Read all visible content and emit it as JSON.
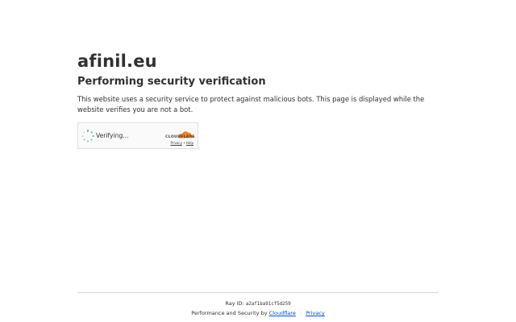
{
  "site": {
    "title": "afinil.eu"
  },
  "main": {
    "heading": "Performing security verification",
    "description": "This website uses a security service to protect against malicious bots. This page is displayed while the website verifies you are not a bot."
  },
  "widget": {
    "status": "Verifying...",
    "brand": "CLOUDFLARE",
    "privacy_link": "Privacy",
    "link_separator": "•",
    "help_link": "Help",
    "brand_color": "#f38020"
  },
  "footer": {
    "ray_label": "Ray ID:",
    "ray_id": "a2af1ba91cf5d259",
    "perf_prefix": "Performance and Security by",
    "cloudflare_link": "Cloudflare",
    "separator": "|",
    "privacy_link": "Privacy",
    "link_color": "#0051c3"
  },
  "icons": {
    "spinner": "loading-spinner-icon",
    "cloud": "cloudflare-cloud-icon"
  }
}
